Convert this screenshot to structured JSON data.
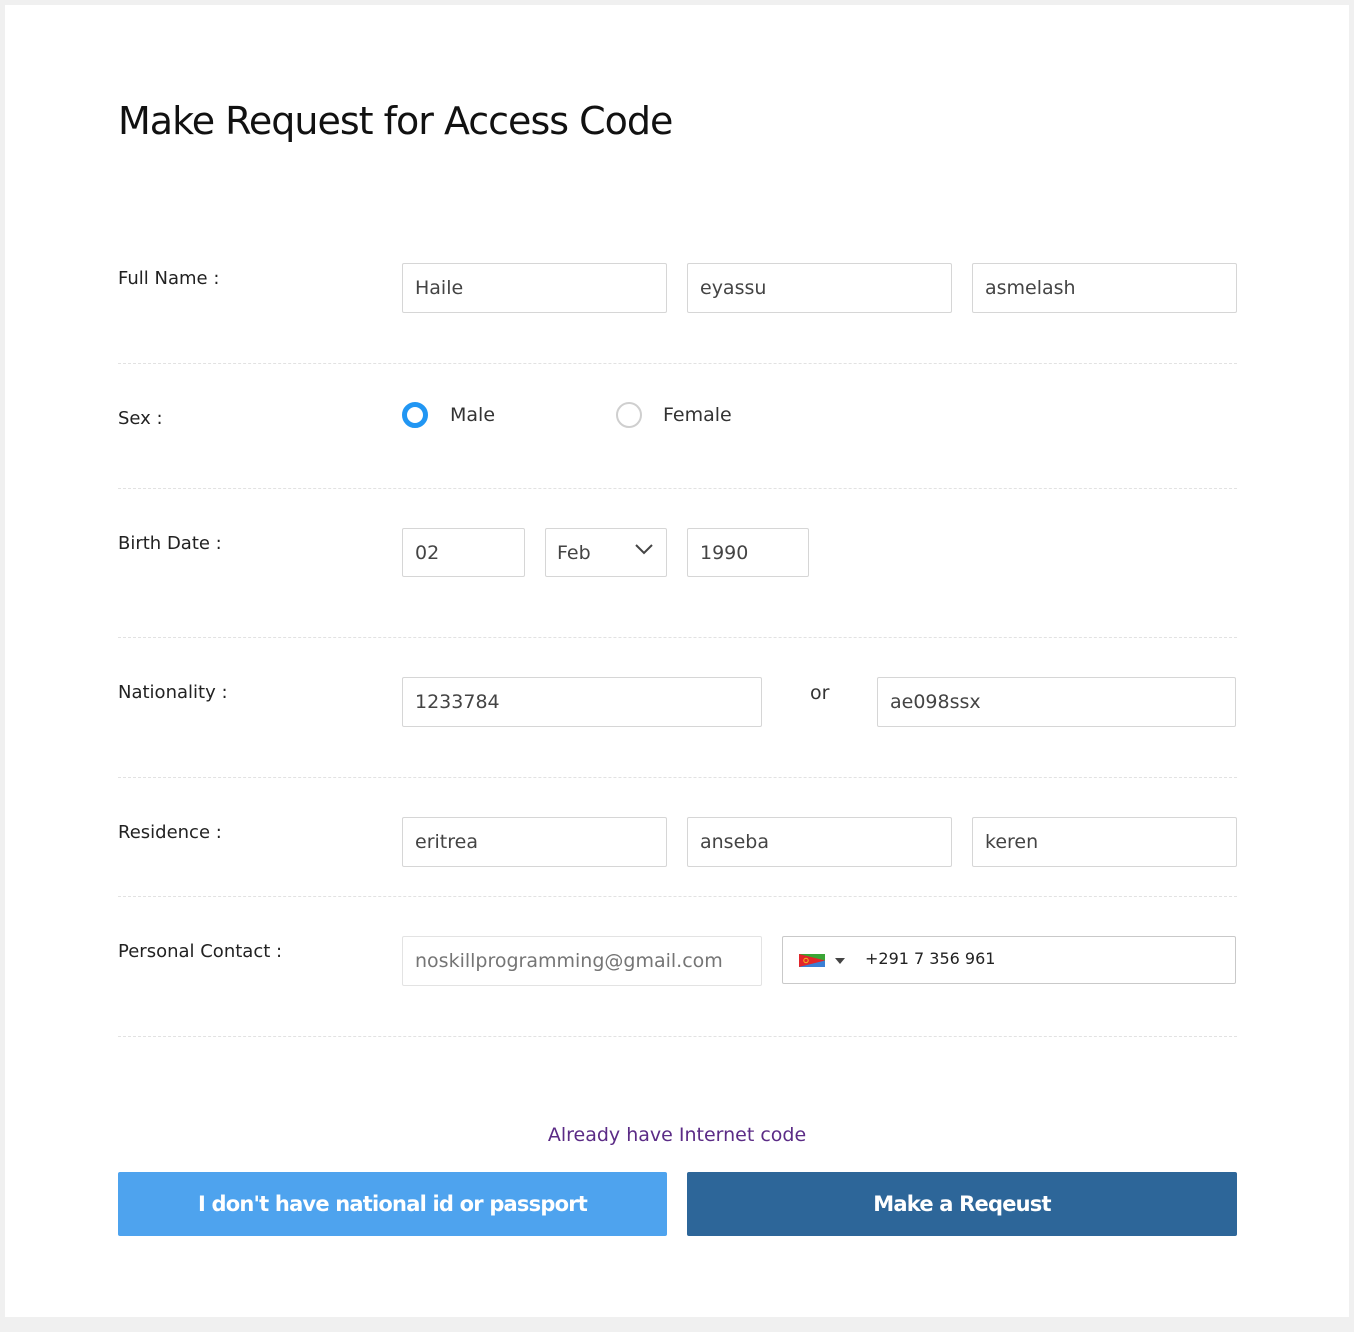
{
  "page": {
    "title": "Make Request for Access Code"
  },
  "full_name": {
    "label": "Full Name :",
    "first": "Haile",
    "middle": "eyassu",
    "last": "asmelash"
  },
  "sex": {
    "label": "Sex :",
    "options": [
      {
        "label": "Male",
        "checked": true
      },
      {
        "label": "Female",
        "checked": false
      }
    ]
  },
  "birth_date": {
    "label": "Birth Date :",
    "day": "02",
    "month": "Feb",
    "year": "1990"
  },
  "nationality": {
    "label": "Nationality :",
    "national_id": "1233784",
    "or_text": "or",
    "passport": "ae098ssx"
  },
  "residence": {
    "label": "Residence :",
    "country": "eritrea",
    "region": "anseba",
    "city": "keren"
  },
  "personal_contact": {
    "label": "Personal Contact :",
    "email_placeholder": "noskillprogramming@gmail.com",
    "phone_flag_icon": "flag-icon",
    "phone": "+291 7 356 961"
  },
  "footer": {
    "link_text": "Already have Internet code",
    "secondary_button": "I don't have national id or passport",
    "primary_button": "Make a Reqeust",
    "secondary_color": "#4ea3ee",
    "primary_color": "#2d6699",
    "link_color": "#5b2b86"
  },
  "colors": {
    "radio_checked": "#2196f3"
  }
}
